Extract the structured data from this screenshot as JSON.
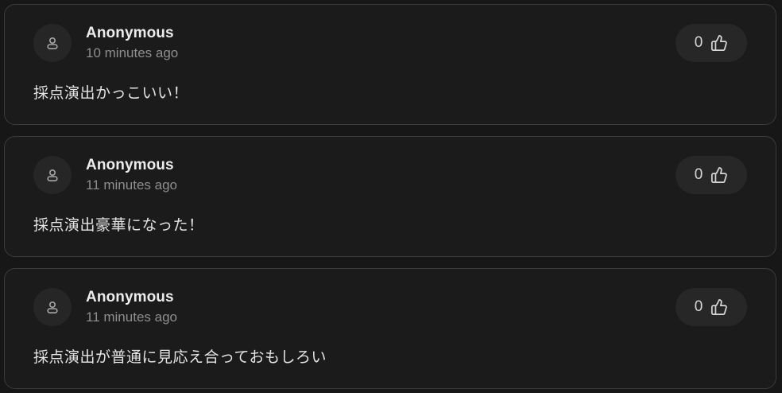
{
  "comments": [
    {
      "author": "Anonymous",
      "time": "10 minutes ago",
      "text": "採点演出かっこいい！",
      "likes": "0",
      "avatar_icon": "user-icon",
      "like_icon": "thumbs-up-icon"
    },
    {
      "author": "Anonymous",
      "time": "11 minutes ago",
      "text": "採点演出豪華になった！",
      "likes": "0",
      "avatar_icon": "user-icon",
      "like_icon": "thumbs-up-icon"
    },
    {
      "author": "Anonymous",
      "time": "11 minutes ago",
      "text": "採点演出が普通に見応え合っておもしろい",
      "likes": "0",
      "avatar_icon": "user-icon",
      "like_icon": "thumbs-up-icon"
    }
  ],
  "colors": {
    "background": "#171717",
    "card": "#1b1b1b",
    "card_border": "#3b3b3b",
    "pill": "#272727",
    "text_primary": "#ececec",
    "text_secondary": "#8e8e8e"
  }
}
